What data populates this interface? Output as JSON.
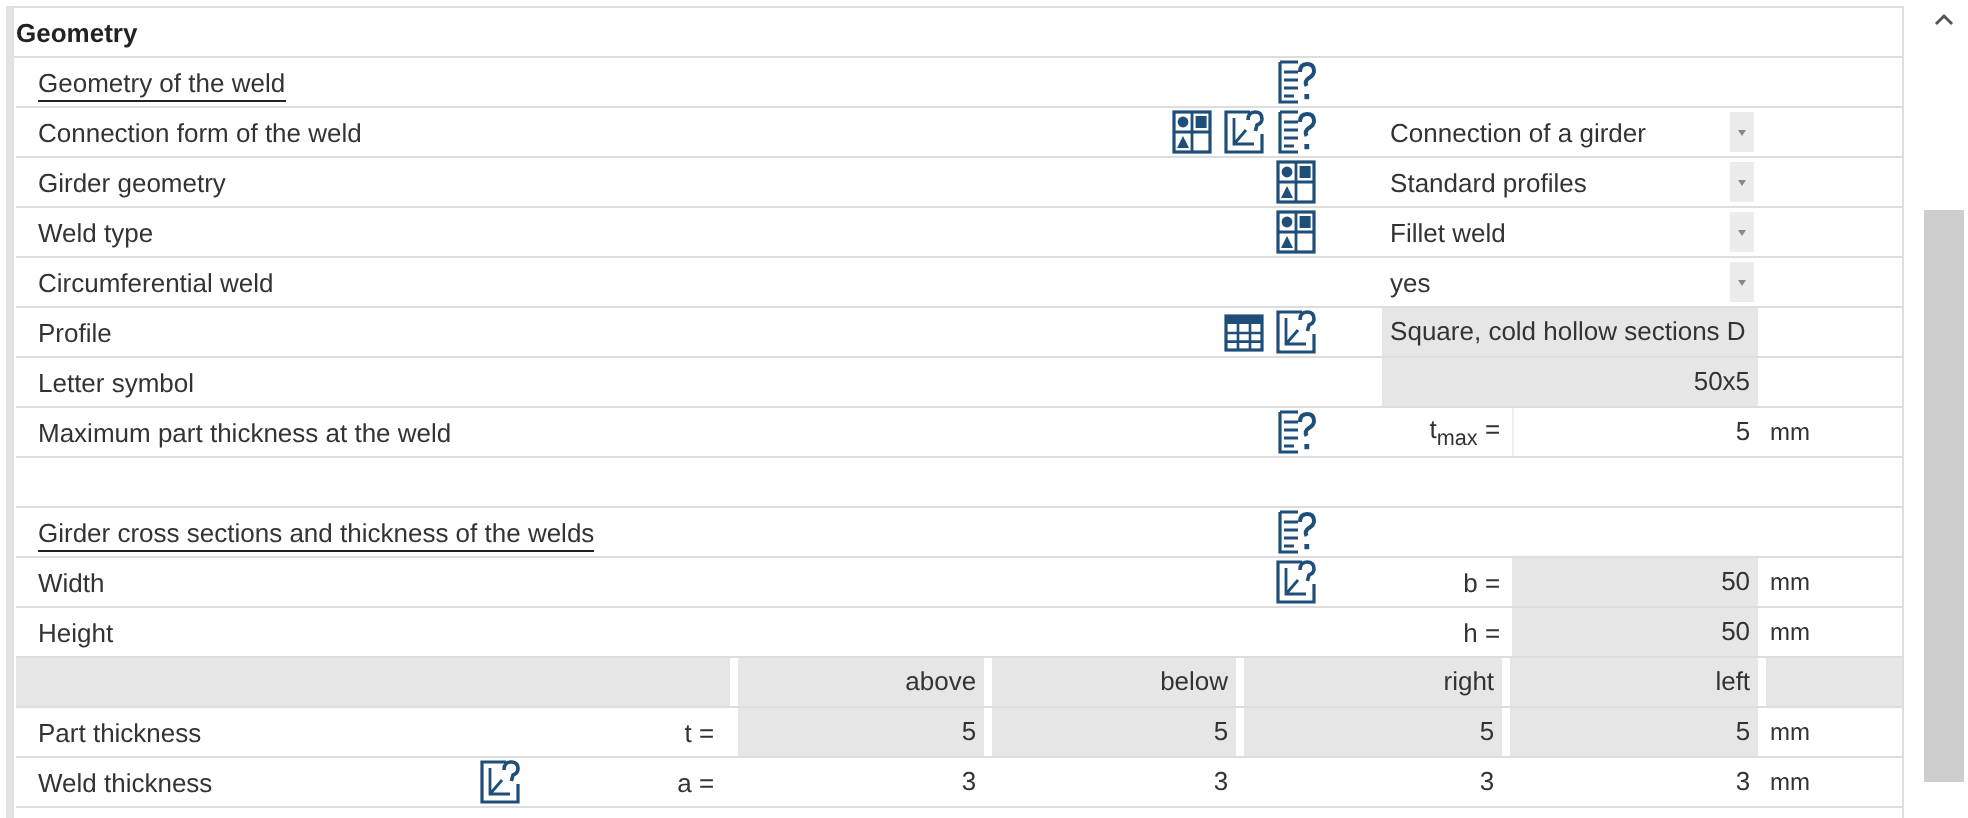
{
  "section_title": "Geometry",
  "rows": [
    {
      "kind": "heading",
      "label": "Geometry of the weld",
      "icons": [
        {
          "kind": "info"
        }
      ]
    },
    {
      "kind": "dropdown",
      "label": "Connection form of the weld",
      "icons": [
        {
          "kind": "choice"
        },
        {
          "kind": "edit"
        },
        {
          "kind": "info"
        }
      ],
      "value": "Connection of a girder"
    },
    {
      "kind": "dropdown",
      "label": "Girder geometry",
      "icons": [
        {
          "kind": "choice"
        }
      ],
      "value": "Standard profiles"
    },
    {
      "kind": "dropdown",
      "label": "Weld type",
      "icons": [
        {
          "kind": "choice"
        }
      ],
      "value": "Fillet weld"
    },
    {
      "kind": "dropdown",
      "label": "Circumferential weld",
      "value": "yes"
    },
    {
      "kind": "text_output",
      "label": "Profile",
      "icons": [
        {
          "kind": "table"
        },
        {
          "kind": "edit"
        }
      ],
      "value": "Square, cold hollow sections D"
    },
    {
      "kind": "text_output_right",
      "label": "Letter symbol",
      "value": "50x5"
    },
    {
      "kind": "number_input",
      "label": "Maximum part thickness at the weld",
      "icons": [
        {
          "kind": "info"
        }
      ],
      "symbol": "t$_{max}$ =",
      "value": "5",
      "unit": "mm"
    },
    {
      "kind": "blank"
    },
    {
      "kind": "heading",
      "label": "Girder cross sections and thickness of the welds",
      "icons": [
        {
          "kind": "info"
        }
      ]
    },
    {
      "kind": "number_output",
      "label": "Width",
      "icons": [
        {
          "kind": "edit"
        }
      ],
      "symbol": "b =",
      "value": "50",
      "unit": "mm"
    },
    {
      "kind": "number_output",
      "label": "Height",
      "symbol": "h =",
      "value": "50",
      "unit": "mm"
    }
  ],
  "thickness_table": {
    "columns": [
      "above",
      "below",
      "right",
      "left"
    ],
    "rows": [
      {
        "label": "Part thickness",
        "symbol": "t =",
        "values": [
          "5",
          "5",
          "5",
          "5"
        ],
        "unit": "mm",
        "editable": false
      },
      {
        "label": "Weld thickness",
        "icons": [
          {
            "kind": "edit"
          }
        ],
        "symbol": "a =",
        "values": [
          "3",
          "3",
          "3",
          "3"
        ],
        "unit": "mm",
        "editable": true
      }
    ]
  }
}
